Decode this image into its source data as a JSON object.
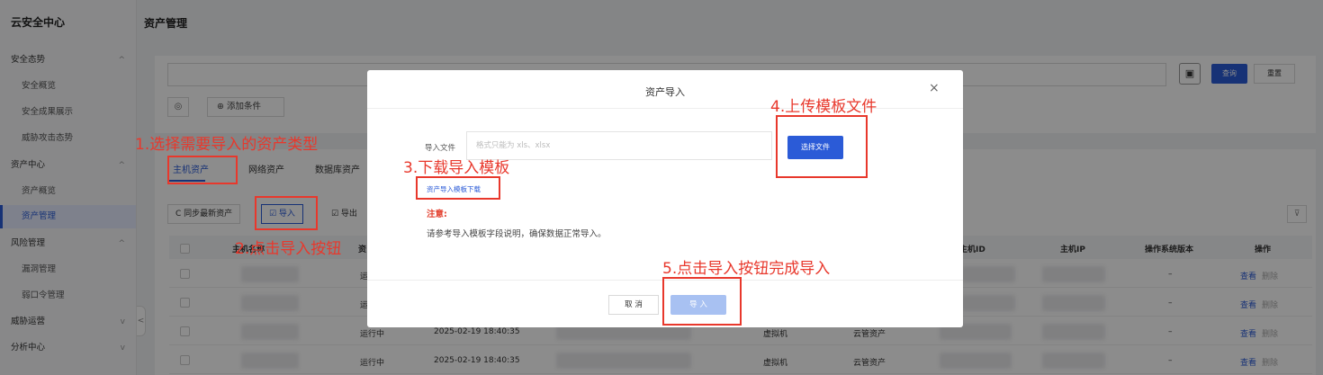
{
  "sidebar": {
    "title": "云安全中心",
    "items": [
      {
        "label": "安全态势",
        "chevron": "^"
      },
      {
        "label": "安全概览"
      },
      {
        "label": "安全成果展示"
      },
      {
        "label": "威胁攻击态势"
      },
      {
        "label": "资产中心",
        "chevron": "^"
      },
      {
        "label": "资产概览"
      },
      {
        "label": "资产管理"
      },
      {
        "label": "风险管理",
        "chevron": "^"
      },
      {
        "label": "漏洞管理"
      },
      {
        "label": "弱口令管理"
      },
      {
        "label": "威胁运营",
        "chevron": "v"
      },
      {
        "label": "分析中心",
        "chevron": "v"
      }
    ],
    "collapse_glyph": "<"
  },
  "page": {
    "title": "资产管理"
  },
  "filter": {
    "input_value": "",
    "save_glyph": "▣",
    "query_label": "查询",
    "reset_label": "重置",
    "settings_glyph": "◎",
    "add_condition_label": "⊕ 添加条件"
  },
  "tabs": [
    "主机资产",
    "网络资产",
    "数据库资产"
  ],
  "toolbar": {
    "sync_label": "C 同步最新资产",
    "import_label": "☑ 导入",
    "export_label": "☑ 导出",
    "filter_glyph": "⊽"
  },
  "table": {
    "headers": [
      "主机名称",
      "资",
      "主机ID",
      "主机IP",
      "操作系统版本",
      "操作"
    ],
    "rows": [
      {
        "status": "运",
        "time": "",
        "type": "",
        "source": "",
        "os": "–",
        "view": "查看",
        "delete": "删除"
      },
      {
        "status": "运",
        "time": "",
        "type": "",
        "source": "",
        "os": "–",
        "view": "查看",
        "delete": "删除"
      },
      {
        "status": "运行中",
        "time": "2025-02-19 18:40:35",
        "type": "虚拟机",
        "source": "云管资产",
        "os": "–",
        "view": "查看",
        "delete": "删除"
      },
      {
        "status": "运行中",
        "time": "2025-02-19 18:40:35",
        "type": "虚拟机",
        "source": "云管资产",
        "os": "–",
        "view": "查看",
        "delete": "删除"
      }
    ]
  },
  "modal": {
    "title": "资产导入",
    "close_glyph": "×",
    "file_label": "导入文件",
    "file_placeholder": "格式只能为 xls、xlsx",
    "choose_file_label": "选择文件",
    "template_link": "资产导入模板下载",
    "note_title": "注意:",
    "note_text": "请参考导入模板字段说明，确保数据正常导入。",
    "cancel_label": "取 消",
    "import_label": "导 入"
  },
  "annotations": {
    "step1": "1.选择需要导入的资产类型",
    "step2": "2.点击导入按钮",
    "step3": "3.下载导入模板",
    "step4": "4.上传模板文件",
    "step5": "5.点击导入按钮完成导入",
    "color": "#e8382c"
  },
  "colors": {
    "primary": "#2b5bd7",
    "danger": "#e23c2a"
  }
}
